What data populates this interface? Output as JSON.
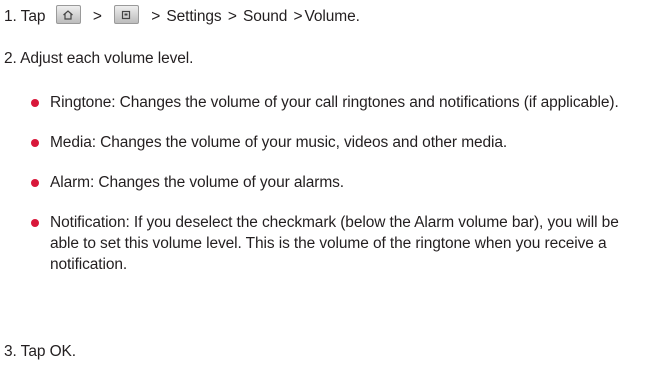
{
  "step1": {
    "num": "1.",
    "tap": "Tap",
    "sep1": ">",
    "sep2": ">",
    "settings": "Settings",
    "sep3": ">",
    "sound": "Sound",
    "sep4": ">",
    "volume": "Volume",
    "end": "."
  },
  "step2": {
    "text": "2. Adjust each volume level."
  },
  "bullets": [
    {
      "term": "Ringtone",
      "text": ": Changes the volume of your call ringtones and notifications (if applicable)."
    },
    {
      "term": "Media",
      "text": ": Changes the volume of your music, videos and other media."
    },
    {
      "term": "Alarm",
      "text": ": Changes the volume of your alarms."
    },
    {
      "term": "Notification",
      "text": ": If you deselect the checkmark (below the Alarm volume bar), you will be able to set this volume level. This is the volume of the ringtone when you receive a notification."
    }
  ],
  "step3": {
    "num": "3.",
    "tap": "Tap",
    "ok": "OK",
    "end": "."
  },
  "colors": {
    "bullet": "#d8173a",
    "text": "#231f20"
  },
  "icons": [
    "home-key-icon",
    "menu-key-icon"
  ]
}
